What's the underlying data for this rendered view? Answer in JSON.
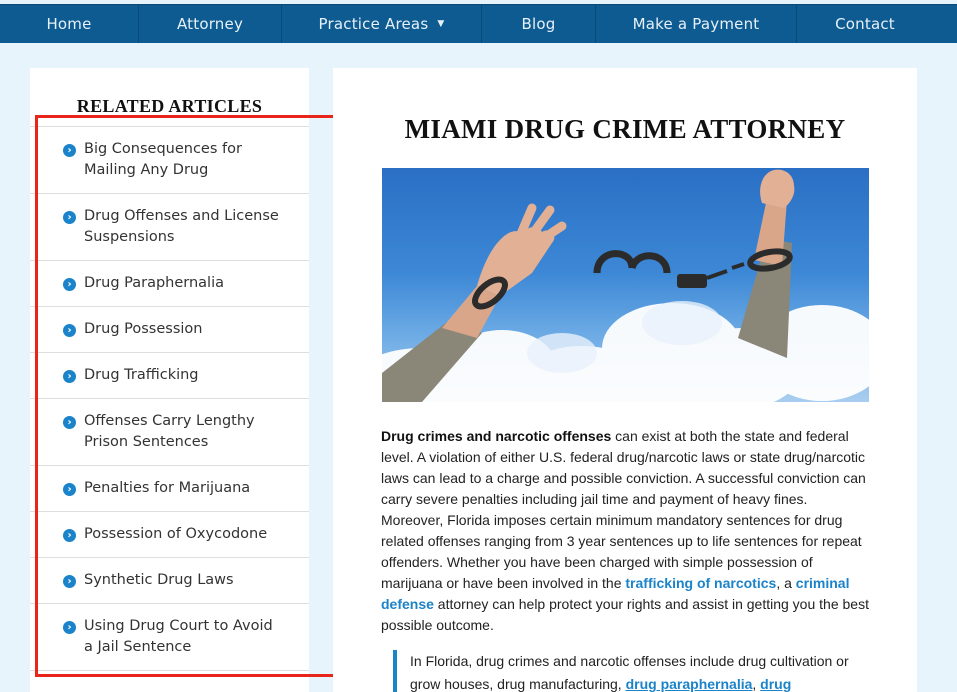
{
  "nav": {
    "items": [
      {
        "label": "Home"
      },
      {
        "label": "Attorney"
      },
      {
        "label": "Practice Areas",
        "has_dropdown": true
      },
      {
        "label": "Blog"
      },
      {
        "label": "Make a Payment"
      },
      {
        "label": "Contact"
      }
    ],
    "caret": "▼"
  },
  "sidebar": {
    "title": "RELATED ARTICLES",
    "bullet_icon": "chevron-right-circle-icon",
    "items": [
      {
        "line1": "Big Consequences for",
        "line2": "Mailing Any Drug"
      },
      {
        "line1": "Drug Offenses and License",
        "line2": "Suspensions"
      },
      {
        "line1": "Drug Paraphernalia",
        "line2": ""
      },
      {
        "line1": "Drug Possession",
        "line2": ""
      },
      {
        "line1": "Drug Trafficking",
        "line2": ""
      },
      {
        "line1": "Offenses Carry Lengthy",
        "line2": "Prison Sentences"
      },
      {
        "line1": "Penalties for Marijuana",
        "line2": ""
      },
      {
        "line1": "Possession of Oxycodone",
        "line2": ""
      },
      {
        "line1": "Synthetic Drug Laws",
        "line2": ""
      },
      {
        "line1": "Using Drug Court to Avoid",
        "line2": "a Jail Sentence"
      }
    ]
  },
  "main": {
    "title": "MIAMI DRUG CRIME ATTORNEY",
    "intro_bold": "Drug crimes and narcotic offenses",
    "intro_text": " can exist at both the state and federal level. A violation of either U.S. federal drug/narcotic laws or state drug/narcotic laws can lead to a charge and possible conviction. A successful conviction can carry severe penalties including jail time and payment of heavy fines. Moreover, Florida imposes certain minimum mandatory sentences for drug related offenses ranging from 3 year sentences up to life sentences for repeat offenders. Whether you have been charged with simple possession of marijuana or have been involved in the ",
    "link_trafficking": "trafficking of narcotics",
    "text_mid": ", a ",
    "link_defense": "criminal defense",
    "text_end": " attorney can help protect your rights and assist in getting you the best possible outcome.",
    "quote_text1": "In Florida, drug crimes and narcotic offenses include drug cultivation or grow houses, drug manufacturing, ",
    "quote_link1": "drug paraphernalia",
    "quote_sep": ", ",
    "quote_link2": "drug"
  },
  "colors": {
    "nav_bg": "#0e5b91",
    "accent": "#1b83c9",
    "highlight": "#e8241b",
    "page_bg": "#e7f4fc"
  }
}
